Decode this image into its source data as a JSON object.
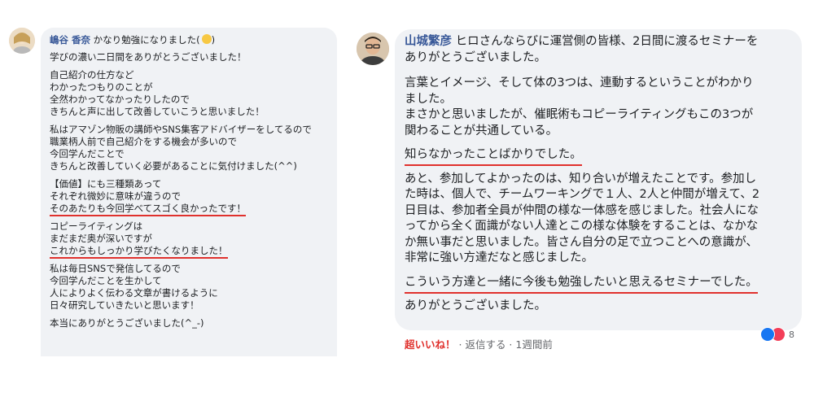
{
  "left_comment": {
    "author": "嶋谷 香奈",
    "intro": "かなり勉強になりました(",
    "intro_end": ")",
    "paragraphs": [
      [
        "学びの濃い二日間をありがとうございました！"
      ],
      [
        "自己紹介の仕方など",
        "わかったつもりのことが",
        "全然わかってなかったりしたので",
        "きちんと声に出して改善していこうと思いました！"
      ],
      [
        "私はアマゾン物販の講師やSNS集客アドバイザーをしてるので",
        "職業柄人前で自己紹介をする機会が多いので",
        "今回学んだことで",
        "きちんと改善していく必要があることに気付けました(^^)"
      ],
      [
        "【価値】にも三種類あって",
        "それぞれ微妙に意味が違うので",
        "そのあたりも今回学べてスゴく良かったです！"
      ],
      [
        "コピーライティングは",
        "まだまだ奥が深いですが",
        "これからもしっかり学びたくなりました！"
      ],
      [
        "私は毎日SNSで発信してるので",
        "今回学んだことを生かして",
        "人によりよく伝わる文章が書けるように",
        "日々研究していきたいと思います！"
      ],
      [
        "本当にありがとうございました(^_-)"
      ]
    ]
  },
  "right_comment": {
    "author": "山城繁彦",
    "first_line": "ヒロさんならびに運営側の皆様、2日間に渡るセミナーを",
    "second_line": "ありがとうございました。",
    "paragraphs": [
      [
        "言葉とイメージ、そして体の3つは、連動するということがわかり",
        "ました。",
        "まさかと思いましたが、催眠術もコピーライティングもこの3つが",
        "関わることが共通している。"
      ],
      [
        "知らなかったことばかりでした。"
      ],
      [
        "あと、参加してよかったのは、知り合いが増えたことです。参加し",
        "た時は、個人で、チームワーキングで１人、2人と仲間が増えて、2",
        "日目は、参加者全員が仲間の様な一体感を感じました。社会人にな",
        "ってから全く面識がない人達とこの様な体験をすることは、なかな",
        "か無い事だと思いました。皆さん自分の足で立つことへの意識が、",
        "非常に強い方達だなと感じました。"
      ],
      [
        "こういう方達と一緒に今後も勉強したいと思えるセミナーでした。"
      ],
      [
        "ありがとうございました。"
      ]
    ],
    "actions": {
      "reaction": "超いいね！",
      "sep1": " · ",
      "reply": "返信する",
      "sep2": " · ",
      "time": "1週間前"
    },
    "reaction_count": "8"
  },
  "colors": {
    "accent_underline": "#e0312d",
    "author_name": "#385898",
    "bubble_bg": "#f0f2f5"
  },
  "icons": [
    "avatar-left",
    "avatar-right",
    "smile-emoji-icon",
    "like-reaction-icon",
    "love-reaction-icon"
  ]
}
